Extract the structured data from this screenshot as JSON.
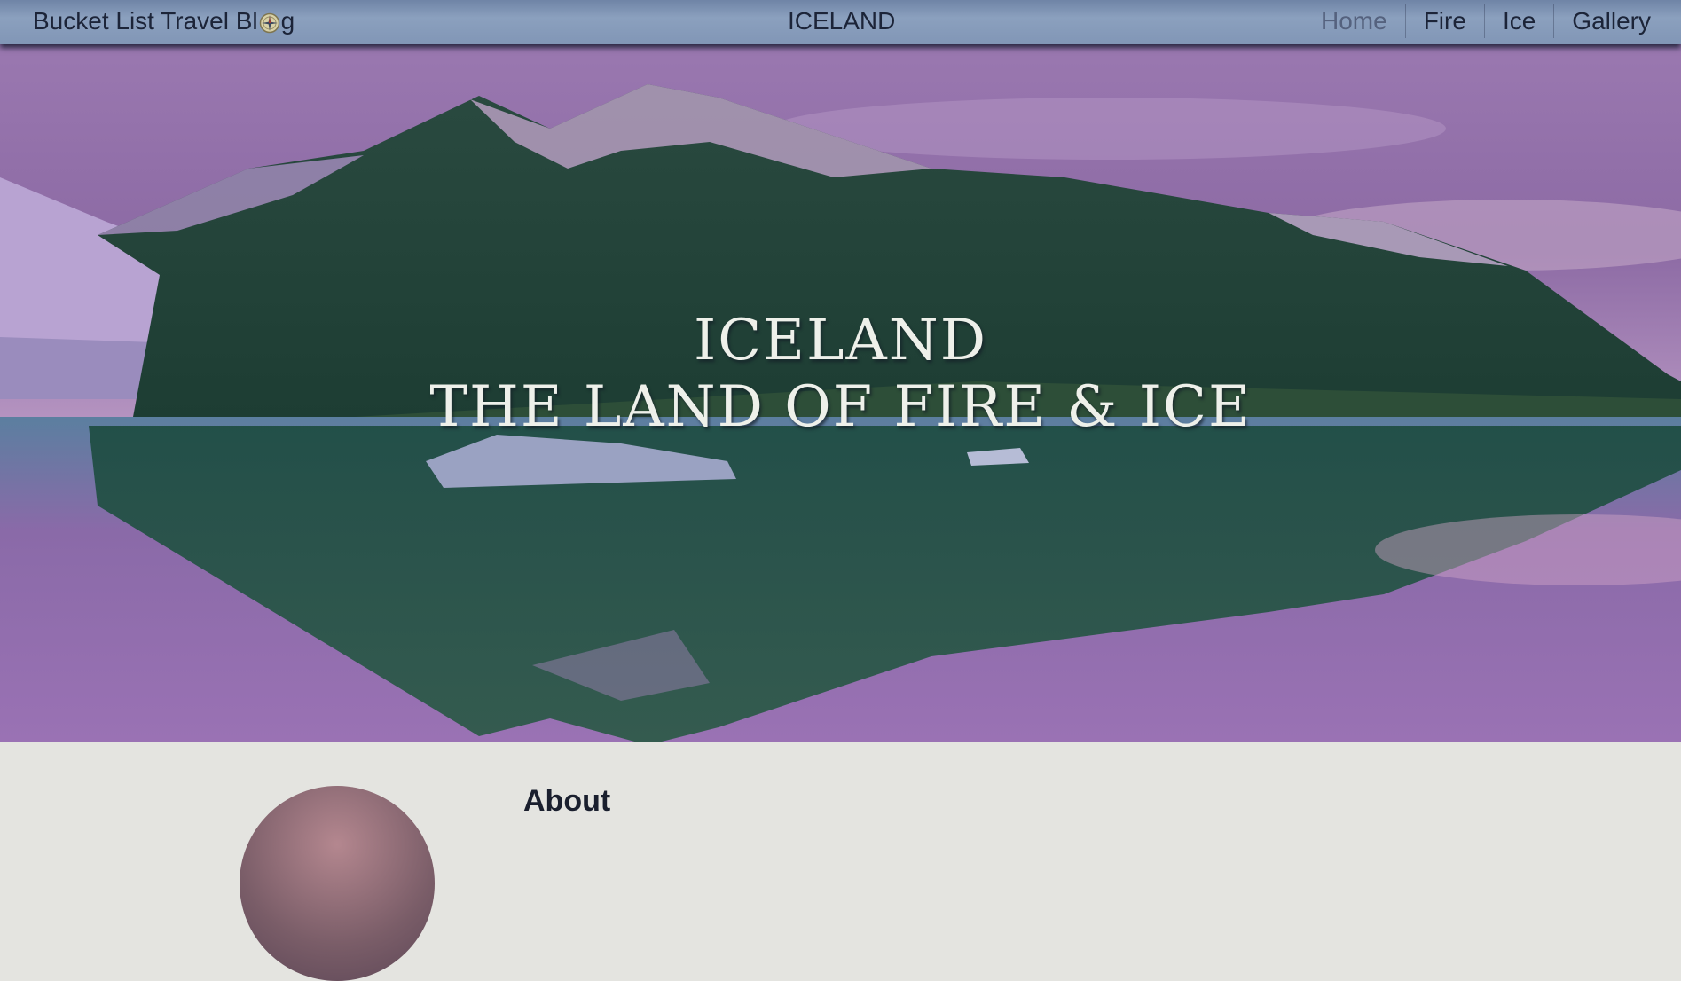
{
  "navbar": {
    "brand_before": "Bucket List Travel Bl",
    "brand_after": "g",
    "brand_icon": "compass-icon",
    "center_title": "ICELAND",
    "links": [
      {
        "label": "Home",
        "active": true
      },
      {
        "label": "Fire",
        "active": false
      },
      {
        "label": "Ice",
        "active": false
      },
      {
        "label": "Gallery",
        "active": false
      }
    ]
  },
  "hero": {
    "title": "ICELAND",
    "subtitle": "THE LAND OF FIRE & ICE"
  },
  "about": {
    "heading": "About"
  },
  "colors": {
    "navbar": "#8196b6",
    "nav_text": "#1c2438",
    "nav_active": "#55627e",
    "page_bg": "#e4e4e0",
    "sky": "#8a6aa2",
    "mountain": "#234a3c"
  }
}
